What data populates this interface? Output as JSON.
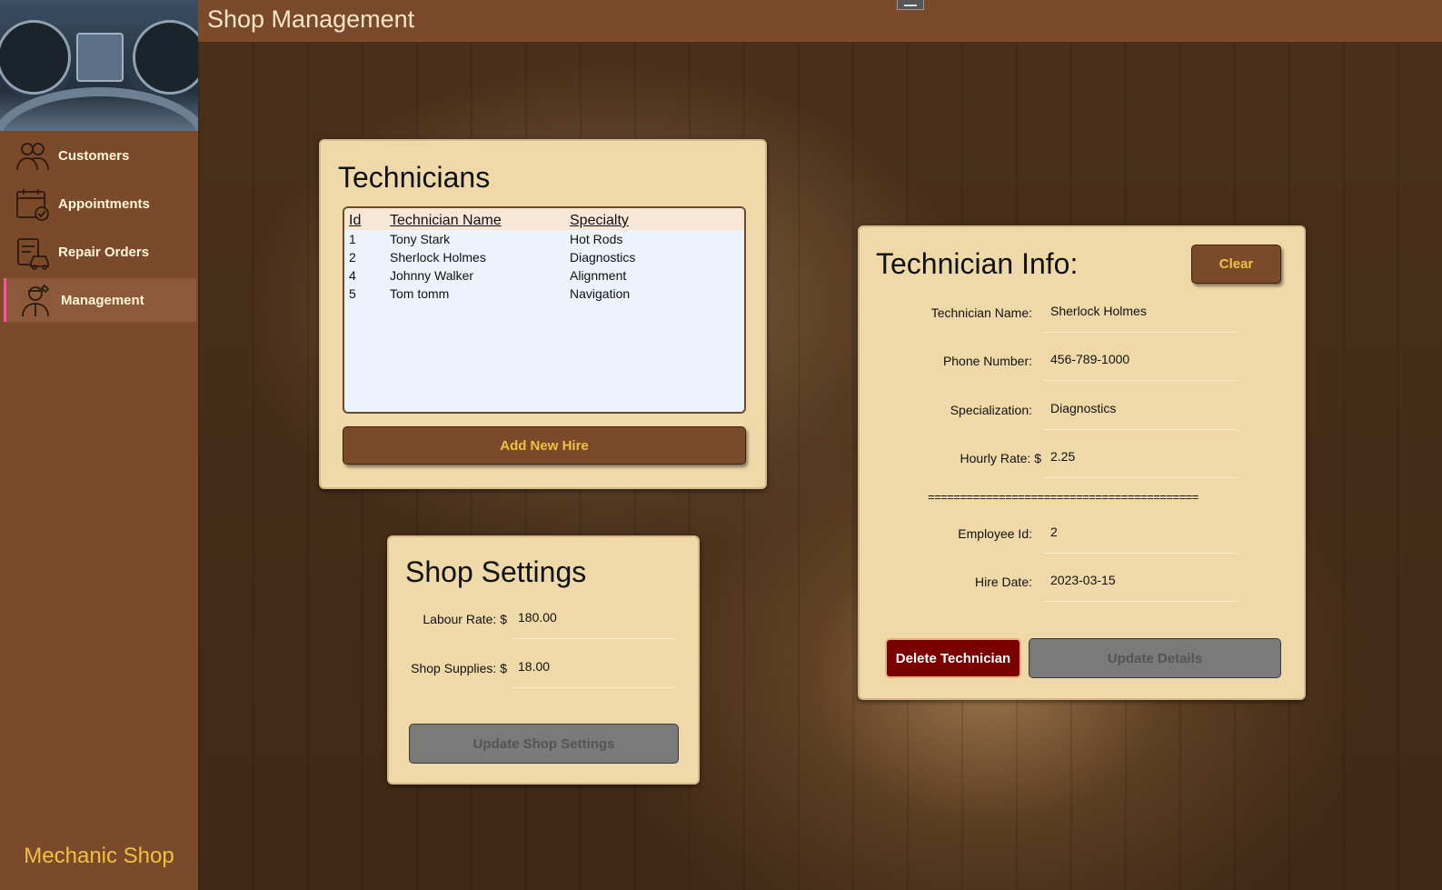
{
  "window": {
    "title": "Shop Management"
  },
  "sidebar": {
    "brand": "Mechanic Shop",
    "items": [
      {
        "label": "Customers",
        "icon": "customers-icon"
      },
      {
        "label": "Appointments",
        "icon": "calendar-icon"
      },
      {
        "label": "Repair Orders",
        "icon": "repair-order-icon"
      },
      {
        "label": "Management",
        "icon": "mechanic-icon",
        "active": true
      }
    ]
  },
  "technicians": {
    "title": "Technicians",
    "columns": [
      "Id",
      "Technician Name",
      "Specialty"
    ],
    "rows": [
      {
        "id": "1",
        "name": "Tony Stark",
        "specialty": "Hot Rods"
      },
      {
        "id": "2",
        "name": "Sherlock Holmes",
        "specialty": "Diagnostics"
      },
      {
        "id": "4",
        "name": "Johnny Walker",
        "specialty": "Alignment"
      },
      {
        "id": "5",
        "name": "Tom tomm",
        "specialty": "Navigation"
      }
    ],
    "add_button": "Add New Hire"
  },
  "shop_settings": {
    "title": "Shop Settings",
    "labour_rate_label": "Labour Rate: $",
    "labour_rate_value": "180.00",
    "shop_supplies_label": "Shop Supplies: $",
    "shop_supplies_value": "18.00",
    "update_button": "Update Shop Settings"
  },
  "technician_info": {
    "title": "Technician Info:",
    "clear_button": "Clear",
    "name_label": "Technician Name:",
    "name_value": "Sherlock Holmes",
    "phone_label": "Phone Number:",
    "phone_value": "456-789-1000",
    "specialization_label": "Specialization:",
    "specialization_value": "Diagnostics",
    "rate_label": "Hourly Rate: $",
    "rate_value": "2.25",
    "separator": "==========================================",
    "employee_id_label": "Employee Id:",
    "employee_id_value": "2",
    "hire_date_label": "Hire Date:",
    "hire_date_value": "2023-03-15",
    "delete_button": "Delete Technician",
    "update_button": "Update Details"
  },
  "colors": {
    "brown": "#7b4a2a",
    "accent": "#f0c040",
    "panel": "#f0d9a8",
    "danger": "#7a0000"
  }
}
